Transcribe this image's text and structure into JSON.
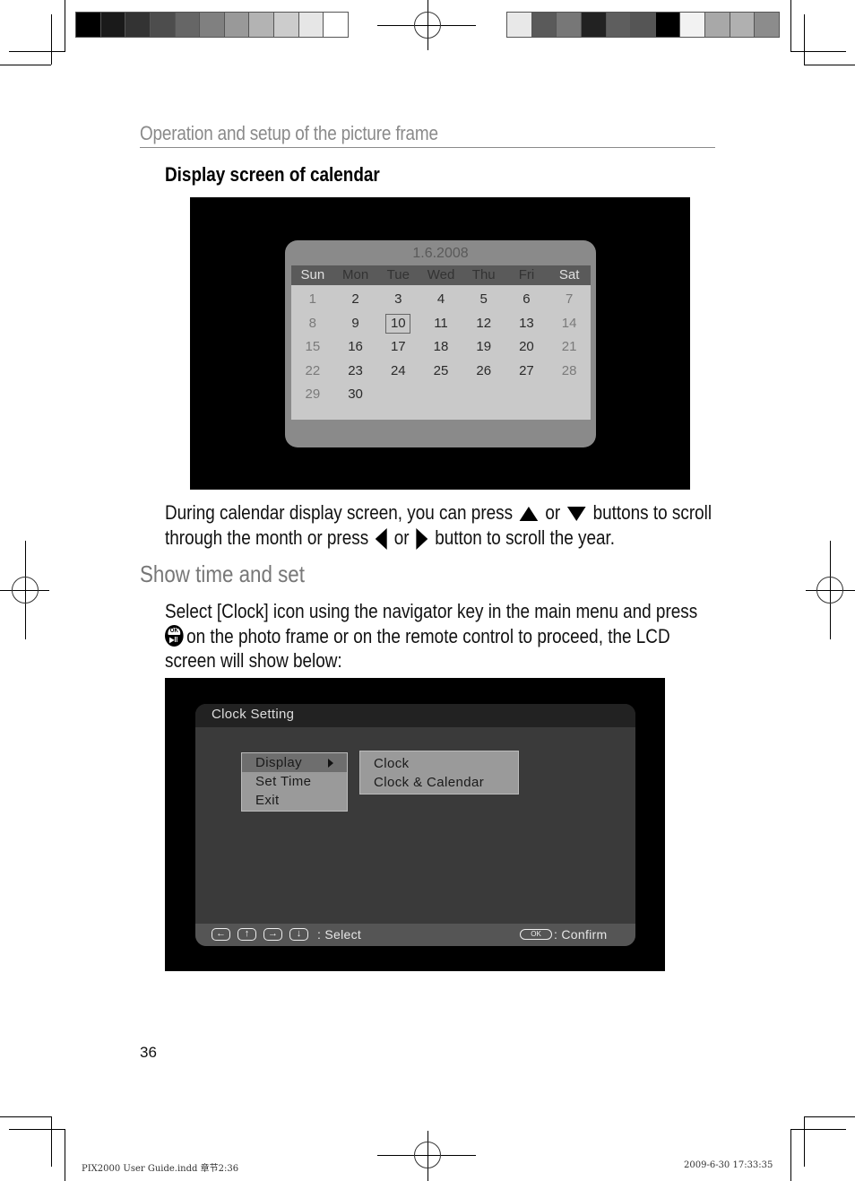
{
  "running_header": "Operation and setup of the picture frame",
  "calendar_section": {
    "heading": "Display screen of calendar",
    "screen": {
      "date_label": "1.6.2008",
      "weekdays": [
        "Sun",
        "Mon",
        "Tue",
        "Wed",
        "Thu",
        "Fri",
        "Sat"
      ],
      "weeks": [
        [
          "1",
          "2",
          "3",
          "4",
          "5",
          "6",
          "7"
        ],
        [
          "8",
          "9",
          "10",
          "11",
          "12",
          "13",
          "14"
        ],
        [
          "15",
          "16",
          "17",
          "18",
          "19",
          "20",
          "21"
        ],
        [
          "22",
          "23",
          "24",
          "25",
          "26",
          "27",
          "28"
        ],
        [
          "29",
          "30",
          "",
          "",
          "",
          "",
          ""
        ]
      ],
      "highlighted_day": "10"
    },
    "instructions": {
      "line1_a": "During calendar display screen, you can press",
      "up_icon": "up-triangle",
      "or_1": "or",
      "down_icon": "down-triangle",
      "line1_b": "buttons to scroll",
      "line2_a": "through the month or press",
      "left_icon": "left-triangle",
      "or_2": "or",
      "right_icon": "right-triangle",
      "line2_b": "button to scroll the year."
    }
  },
  "time_section": {
    "heading": "Show time and set",
    "para_line1": "Select [Clock] icon using the navigator key in the main menu and press",
    "ok_icon_top": "OK",
    "ok_icon_bottom": "▶II",
    "para_line2": "on the photo frame or on the remote control to proceed, the LCD",
    "para_line3": "screen will show below:",
    "screen": {
      "title": "Clock Setting",
      "main_menu": [
        {
          "label": "Display",
          "selected": true,
          "has_submenu": true
        },
        {
          "label": "Set Time",
          "selected": false
        },
        {
          "label": "Exit",
          "selected": false
        }
      ],
      "submenu": [
        {
          "label": "Clock"
        },
        {
          "label": "Clock & Calendar"
        }
      ],
      "footer": {
        "nav_keys": [
          "←",
          "↑",
          "→",
          "↓"
        ],
        "select_label": ":  Select",
        "ok_key": "OK",
        "confirm_label": ": Confirm"
      }
    }
  },
  "page_number": "36",
  "slug": {
    "file": "PIX2000 User Guide.indd   章节2:36",
    "timestamp": "2009-6-30   17:33:35"
  },
  "print_marks": {
    "left_swatches": [
      "#000000",
      "#1a1a1a",
      "#333333",
      "#4d4d4d",
      "#666666",
      "#808080",
      "#999999",
      "#b3b3b3",
      "#cccccc",
      "#e6e6e6",
      "#ffffff"
    ],
    "right_swatches": [
      "#e8e8e8",
      "#5a5a5a",
      "#777777",
      "#222222",
      "#5e5e5e",
      "#555555",
      "#000000",
      "#f2f2f2",
      "#a8a8a8",
      "#b0b0b0",
      "#8c8c8c"
    ]
  }
}
